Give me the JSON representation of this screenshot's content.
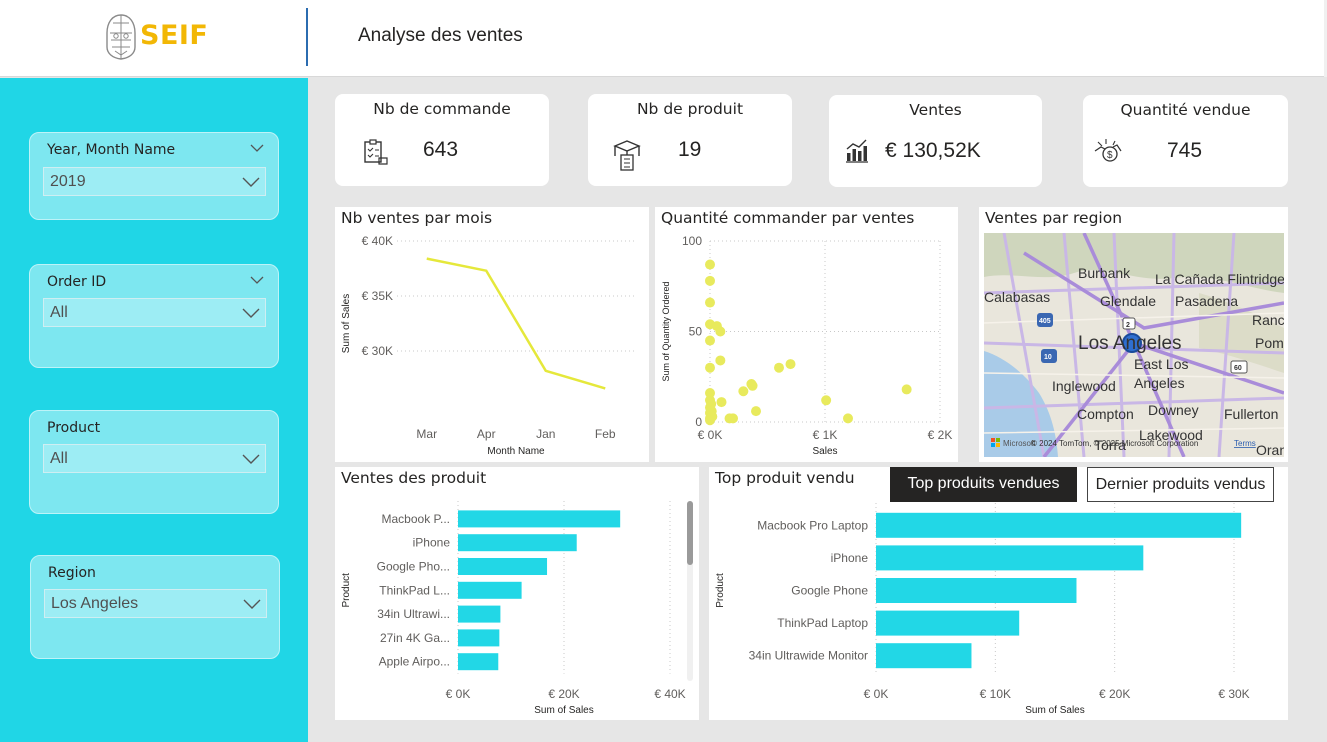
{
  "header": {
    "logo_text": "SEIF",
    "title": "Analyse des ventes"
  },
  "slicers": [
    {
      "title": "Year, Month Name",
      "value": "2019"
    },
    {
      "title": "Order ID",
      "value": "All"
    },
    {
      "title": "Product",
      "value": "All"
    },
    {
      "title": "Region",
      "value": "Los Angeles"
    }
  ],
  "cards": [
    {
      "title": "Nb de commande",
      "value": "643",
      "icon": "clipboard-icon"
    },
    {
      "title": "Nb de produit",
      "value": "19",
      "icon": "box-icon"
    },
    {
      "title": "Ventes",
      "value": "€ 130,52K",
      "icon": "bar-chart-icon"
    },
    {
      "title": "Quantité vendue",
      "value": "745",
      "icon": "money-hand-icon"
    }
  ],
  "map": {
    "title": "Ventes par region",
    "labels": [
      "Burbank",
      "La Cañada Flintridge",
      "Calabasas",
      "Glendale",
      "Pasadena",
      "Ranchc",
      "Los Angeles",
      "Pom",
      "East Los",
      "Angeles",
      "Inglewood",
      "Compton",
      "Downey",
      "Fullerton",
      "Lakewood",
      "Torra",
      "Oran"
    ],
    "route_badges": [
      "405",
      "2",
      "10",
      "60"
    ],
    "copyright": "© 2024 TomTom, © 2025 Microsoft Corporation",
    "terms": "Terms",
    "ms_label": "Microsoft"
  },
  "buttons": {
    "top": "Top produits vendues",
    "last": "Dernier produits vendus"
  },
  "colors": {
    "accent": "#20d6e6",
    "line": "#e5e83b",
    "scatter": "#e8ea5d",
    "bar": "#22d7e6",
    "logo": "#f2b705",
    "header_divider": "#2b6cb0"
  },
  "chart_data": [
    {
      "id": "line",
      "type": "line",
      "title": "Nb ventes par mois",
      "categories": [
        "Mar",
        "Apr",
        "Jan",
        "Feb"
      ],
      "values": [
        38400,
        37300,
        28200,
        26600
      ],
      "xlabel": "Month Name",
      "ylabel": "Sum of Sales",
      "yticks": [
        30000,
        35000,
        40000
      ],
      "ytick_labels": [
        "€ 30K",
        "€ 35K",
        "€ 40K"
      ],
      "ylim": [
        25000,
        40000
      ],
      "grid": true
    },
    {
      "id": "scatter",
      "type": "scatter",
      "title": "Quantité commander par ventes",
      "xlabel": "Sales",
      "ylabel": "Sum of Quantity Ordered",
      "xlim": [
        0,
        2000
      ],
      "ylim": [
        0,
        100
      ],
      "xticks": [
        0,
        1000,
        2000
      ],
      "xtick_labels": [
        "€ 0K",
        "€ 1K",
        "€ 2K"
      ],
      "yticks": [
        0,
        50,
        100
      ],
      "ytick_labels": [
        "0",
        "50",
        "100"
      ],
      "grid": true,
      "points": [
        [
          0,
          87
        ],
        [
          0,
          78
        ],
        [
          0,
          66
        ],
        [
          0,
          54
        ],
        [
          0,
          45
        ],
        [
          0,
          30
        ],
        [
          0,
          16
        ],
        [
          0,
          12
        ],
        [
          0,
          8
        ],
        [
          0,
          5
        ],
        [
          0,
          2
        ],
        [
          0,
          1
        ],
        [
          10,
          10
        ],
        [
          15,
          6
        ],
        [
          20,
          3
        ],
        [
          60,
          53
        ],
        [
          90,
          50
        ],
        [
          90,
          34
        ],
        [
          100,
          11
        ],
        [
          170,
          2
        ],
        [
          200,
          2
        ],
        [
          290,
          17
        ],
        [
          360,
          21
        ],
        [
          370,
          20
        ],
        [
          400,
          6
        ],
        [
          600,
          30
        ],
        [
          700,
          32
        ],
        [
          1010,
          12
        ],
        [
          1200,
          2
        ],
        [
          1710,
          18
        ]
      ]
    },
    {
      "id": "hbar1",
      "type": "bar",
      "orientation": "horizontal",
      "title": "Ventes des produit",
      "categories": [
        "Macbook P...",
        "iPhone",
        "Google Pho...",
        "ThinkPad L...",
        "34in Ultrawi...",
        "27in 4K Ga...",
        "Apple Airpo..."
      ],
      "values": [
        30600,
        22400,
        16800,
        12000,
        8000,
        7800,
        7600
      ],
      "xlabel": "Sum of Sales",
      "ylabel": "Product",
      "xlim": [
        0,
        40000
      ],
      "xticks": [
        0,
        20000,
        40000
      ],
      "xtick_labels": [
        "€ 0K",
        "€ 20K",
        "€ 40K"
      ],
      "grid": true
    },
    {
      "id": "hbar2",
      "type": "bar",
      "orientation": "horizontal",
      "title": "Top produit vendu",
      "categories": [
        "Macbook Pro Laptop",
        "iPhone",
        "Google Phone",
        "ThinkPad Laptop",
        "34in Ultrawide Monitor"
      ],
      "values": [
        30600,
        22400,
        16800,
        12000,
        8000
      ],
      "xlabel": "Sum of Sales",
      "ylabel": "Product",
      "xlim": [
        0,
        30000
      ],
      "xticks": [
        0,
        10000,
        20000,
        30000
      ],
      "xtick_labels": [
        "€ 0K",
        "€ 10K",
        "€ 20K",
        "€ 30K"
      ],
      "grid": true
    }
  ]
}
